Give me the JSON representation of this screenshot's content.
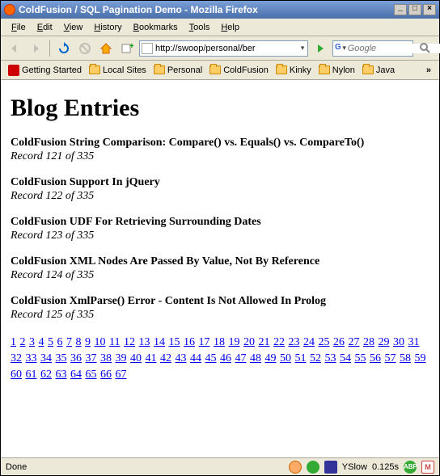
{
  "window": {
    "title": "ColdFusion / SQL Pagination Demo - Mozilla Firefox"
  },
  "menu": {
    "file": "File",
    "edit": "Edit",
    "view": "View",
    "history": "History",
    "bookmarks": "Bookmarks",
    "tools": "Tools",
    "help": "Help"
  },
  "urlbar": {
    "value": "http://swoop/personal/ber"
  },
  "search": {
    "placeholder": "Google"
  },
  "bookmarks": {
    "items": [
      {
        "label": "Getting Started"
      },
      {
        "label": "Local Sites"
      },
      {
        "label": "Personal"
      },
      {
        "label": "ColdFusion"
      },
      {
        "label": "Kinky"
      },
      {
        "label": "Nylon"
      },
      {
        "label": "Java"
      }
    ]
  },
  "page": {
    "heading": "Blog Entries",
    "entries": [
      {
        "title": "ColdFusion String Comparison: Compare() vs. Equals() vs. CompareTo()",
        "record": "Record 121 of 335"
      },
      {
        "title": "ColdFusion Support In jQuery",
        "record": "Record 122 of 335"
      },
      {
        "title": "ColdFusion UDF For Retrieving Surrounding Dates",
        "record": "Record 123 of 335"
      },
      {
        "title": "ColdFusion XML Nodes Are Passed By Value, Not By Reference",
        "record": "Record 124 of 335"
      },
      {
        "title": "ColdFusion XmlParse() Error - Content Is Not Allowed In Prolog",
        "record": "Record 125 of 335"
      }
    ],
    "total_pages": 67
  },
  "status": {
    "done": "Done",
    "yslow": "YSlow",
    "time": "0.125s"
  }
}
